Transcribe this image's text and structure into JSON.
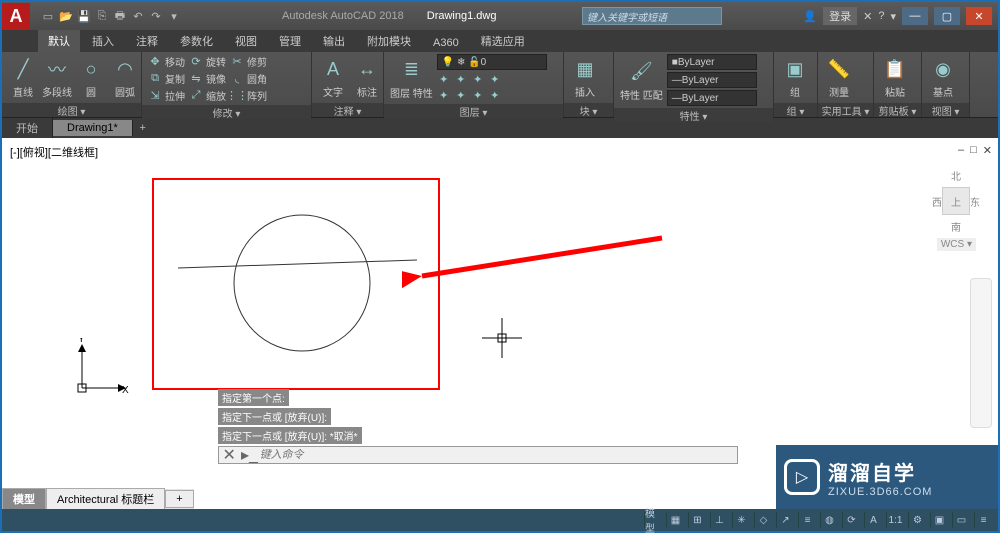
{
  "title": {
    "app": "Autodesk AutoCAD 2018",
    "file": "Drawing1.dwg",
    "search_placeholder": "键入关键字或短语",
    "login": "登录"
  },
  "ribbon_tabs": [
    "默认",
    "插入",
    "注释",
    "参数化",
    "视图",
    "管理",
    "输出",
    "附加模块",
    "A360",
    "精选应用"
  ],
  "panels": {
    "draw": {
      "title": "绘图 ▾",
      "line": "直线",
      "polyline": "多段线",
      "circle": "圆",
      "arc": "圆弧"
    },
    "modify": {
      "title": "修改 ▾",
      "move": "移动",
      "rotate": "旋转",
      "trim": "修剪",
      "copy": "复制",
      "mirror": "镜像",
      "fillet": "圆角",
      "stretch": "拉伸",
      "scale": "缩放",
      "array": "阵列"
    },
    "annot": {
      "title": "注释 ▾",
      "text": "文字",
      "dim": "标注"
    },
    "layers": {
      "title": "图层 ▾",
      "props": "图层\n特性",
      "current": "0"
    },
    "block": {
      "title": "块 ▾",
      "insert": "插入"
    },
    "props": {
      "title": "特性 ▾",
      "matchprop": "特性\n匹配",
      "bylayer1": "ByLayer",
      "bylayer2": "ByLayer",
      "bylayer3": "ByLayer"
    },
    "groups": {
      "title": "组 ▾",
      "group": "组"
    },
    "utils": {
      "title": "实用工具 ▾",
      "measure": "测量"
    },
    "clip": {
      "title": "剪贴板 ▾",
      "paste": "粘贴"
    },
    "view": {
      "title": "视图 ▾",
      "base": "基点"
    }
  },
  "doc_tabs": {
    "start": "开始",
    "active": "Drawing1*",
    "plus": "+"
  },
  "viewport": {
    "label": "[-][俯视][二维线框]",
    "min": "–",
    "restore": "□",
    "close": "✕"
  },
  "viewcube": {
    "n": "北",
    "s": "南",
    "e": "东",
    "face": "上",
    "wcs": "WCS ▾"
  },
  "ucs": {
    "x": "X",
    "y": "Y"
  },
  "cmd": {
    "l1": "指定第一个点:",
    "l2": "指定下一点或 [放弃(U)]:",
    "l3": "指定下一点或 [放弃(U)]: *取消*",
    "placeholder": "键入命令"
  },
  "layout": {
    "model": "模型",
    "arch": "Architectural 标题栏",
    "plus": "+"
  },
  "status": {
    "model": "模型",
    "zoom": "1:1"
  },
  "watermark": {
    "brand": "溜溜自学",
    "url": "ZIXUE.3D66.COM"
  }
}
